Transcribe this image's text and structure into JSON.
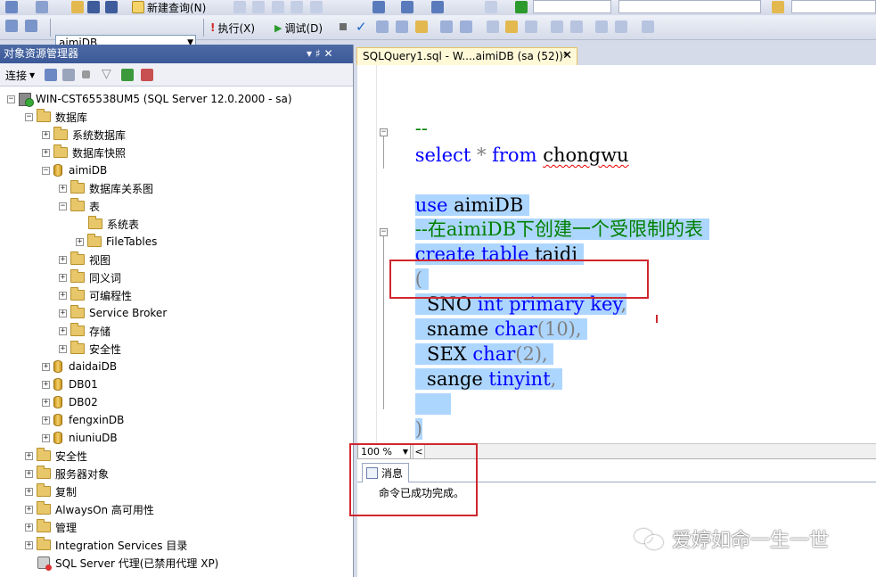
{
  "toolbar": {
    "new_query_label": "新建查询(N)",
    "database_selector_value": "aimiDB",
    "execute_label": "执行(X)",
    "debug_label": "调试(D)"
  },
  "object_explorer": {
    "title": "对象资源管理器",
    "pin_glyph": "▾ ♯ ✕",
    "connect_label": "连接",
    "server": "WIN-CST65538UM5 (SQL Server 12.0.2000 - sa)",
    "databases": "数据库",
    "system_databases": "系统数据库",
    "db_snapshots": "数据库快照",
    "aimidb": "aimiDB",
    "db_diagrams": "数据库关系图",
    "tables": "表",
    "system_tables": "系统表",
    "filetables": "FileTables",
    "views": "视图",
    "synonyms": "同义词",
    "programmability": "可编程性",
    "service_broker": "Service Broker",
    "storage": "存储",
    "db_security": "安全性",
    "daidaidb": "daidaiDB",
    "db01": "DB01",
    "db02": "DB02",
    "fengxindb": "fengxinDB",
    "niuniudb": "niuniuDB",
    "security": "安全性",
    "server_objects": "服务器对象",
    "replication": "复制",
    "alwayson": "AlwaysOn 高可用性",
    "management": "管理",
    "integration_services": "Integration Services 目录",
    "sql_agent": "SQL Server 代理(已禁用代理 XP)"
  },
  "editor": {
    "tab_title": "SQLQuery1.sql - W....aimiDB (sa (52))*",
    "tab_close": "✕",
    "lines": {
      "l1": "--",
      "l2_kw1": "select",
      "l2_mid": " * ",
      "l2_kw2": "from",
      "l2_obj": "chongwu",
      "l3_kw": "use",
      "l3_obj": " aimiDB ",
      "l4": "--在aimiDB下创建一个受限制的表 ",
      "l5_kw": "create table",
      "l5_obj": " taidi ",
      "l6": "(",
      "l7_a": "  SNO ",
      "l7_b": "int primary key",
      "l7_c": ",",
      "l8_a": "  sname ",
      "l8_b": "char",
      "l8_c": "(10),",
      "l9_a": "  SEX ",
      "l9_b": "char",
      "l9_c": "(2),",
      "l10_a": "  sange ",
      "l10_b": "tinyint",
      "l10_c": ",",
      "l12": ")"
    }
  },
  "status": {
    "zoom": "100 %",
    "scroll_left": "<"
  },
  "results": {
    "tab_label": "消息",
    "message": "命令已成功完成。"
  },
  "watermark": "爱婷如命一生一世",
  "colors": {
    "keyword": "#0000ff",
    "comment": "#008000",
    "operator": "#808080",
    "selection": "#add6ff",
    "highlight_box": "#d0262e"
  }
}
